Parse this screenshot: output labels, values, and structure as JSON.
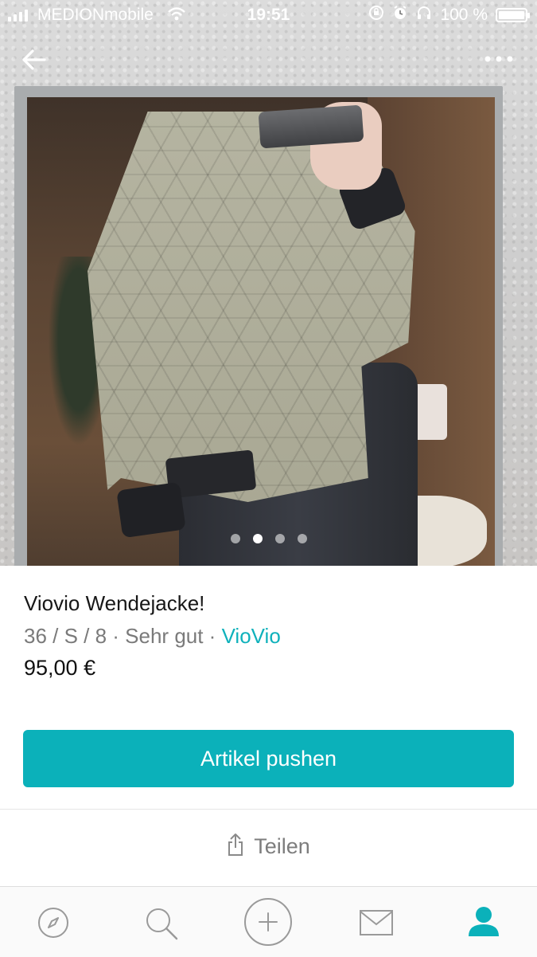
{
  "status_bar": {
    "carrier": "MEDIONmobile",
    "time": "19:51",
    "battery": "100 %",
    "battery_level": 1.0
  },
  "gallery": {
    "image_count": 4,
    "active_index": 1
  },
  "item": {
    "title": "Viovio Wendejacke!",
    "details": "36 / S / 8 · Sehr gut · ",
    "brand": "VioVio",
    "price": "95,00 €"
  },
  "actions": {
    "push_label": "Artikel pushen",
    "share_label": "Teilen"
  },
  "tabbar": {
    "items": [
      "compass-icon",
      "search-icon",
      "add-icon",
      "mail-icon",
      "profile-icon"
    ],
    "active": "profile-icon"
  },
  "colors": {
    "accent": "#0bb1ba",
    "brand_link": "#0fb1bb",
    "muted_text": "#7a7a7a",
    "tab_icon": "#9a9a9a"
  }
}
